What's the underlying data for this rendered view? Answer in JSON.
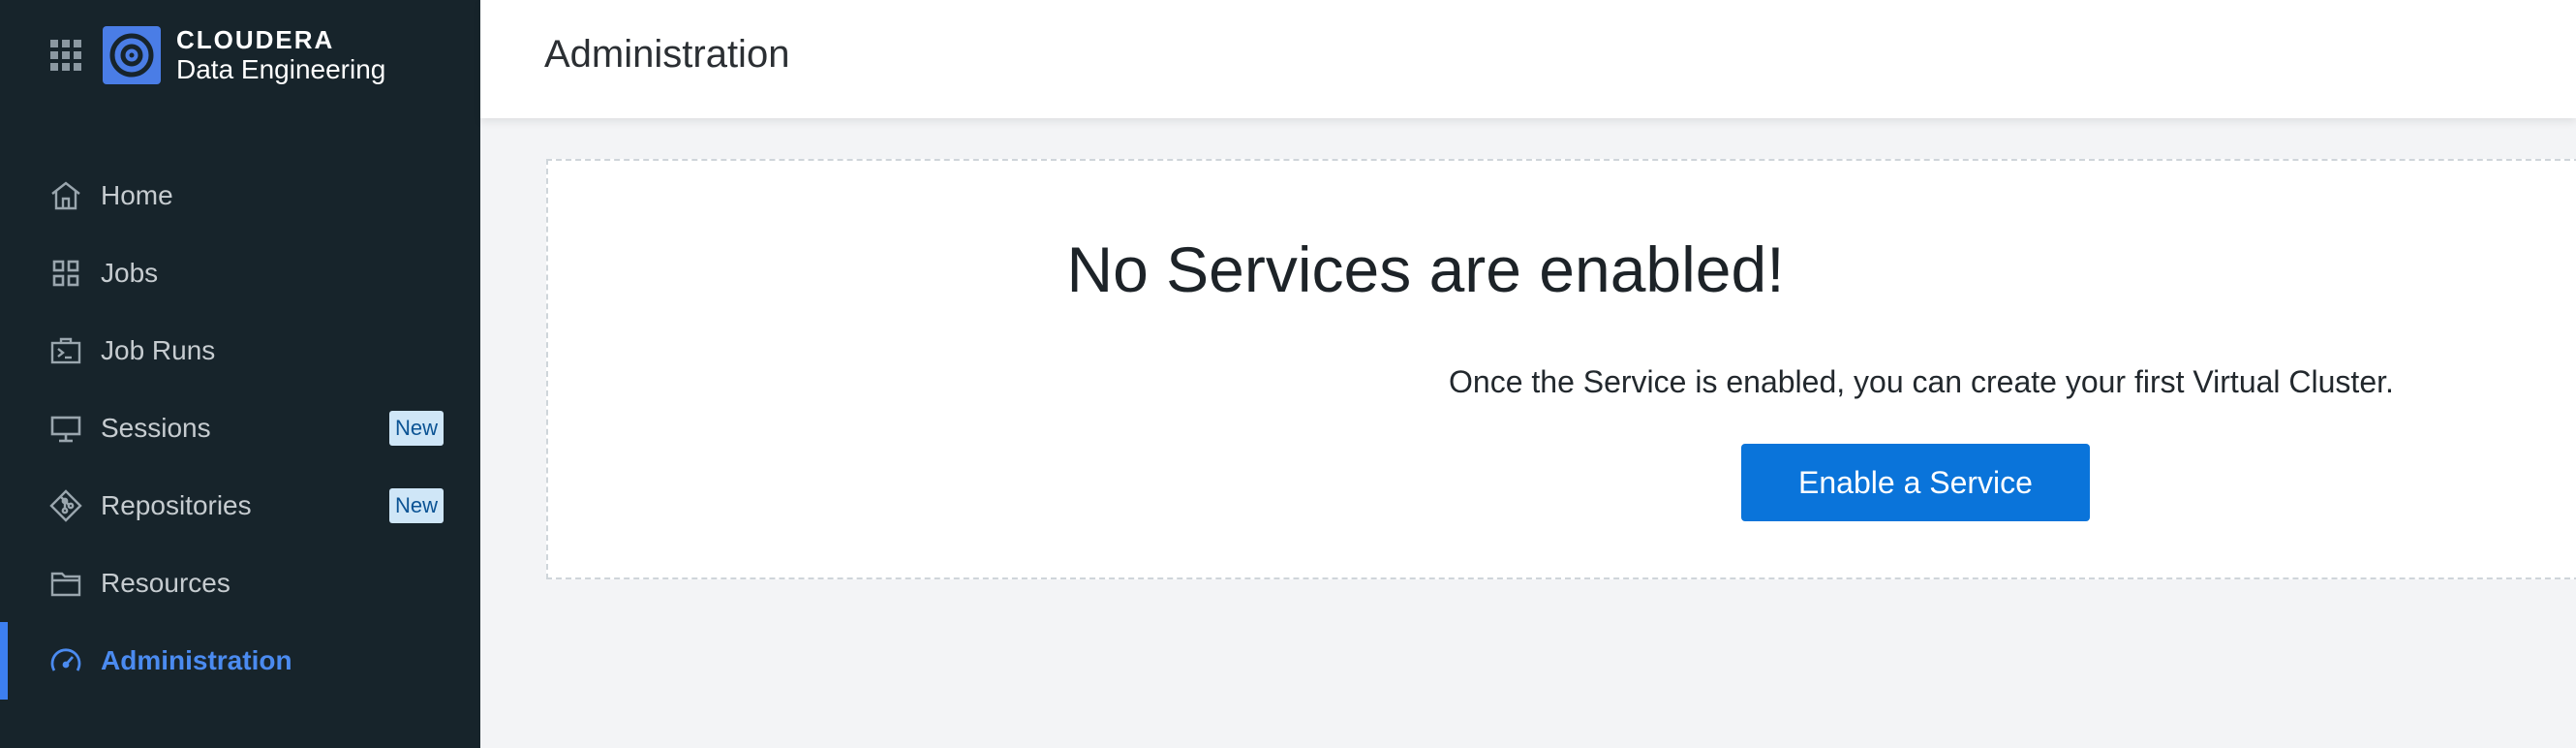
{
  "brand": {
    "company": "CLOUDERA",
    "product": "Data Engineering",
    "logo_color": "#4a7de6"
  },
  "sidebar": {
    "items": [
      {
        "label": "Home",
        "icon": "home-icon"
      },
      {
        "label": "Jobs",
        "icon": "grid-icon"
      },
      {
        "label": "Job Runs",
        "icon": "terminal-case-icon"
      },
      {
        "label": "Sessions",
        "icon": "monitor-icon",
        "badge": "New"
      },
      {
        "label": "Repositories",
        "icon": "git-icon",
        "badge": "New"
      },
      {
        "label": "Resources",
        "icon": "folder-icon"
      },
      {
        "label": "Administration",
        "icon": "gauge-icon",
        "active": true
      }
    ]
  },
  "header": {
    "title": "Administration"
  },
  "main": {
    "empty_title": "No Services are enabled!",
    "empty_message": "Once the Service is enabled, you can create your first Virtual Cluster.",
    "cta_label": "Enable a Service"
  },
  "colors": {
    "sidebar_bg": "#17242b",
    "accent": "#0a74da",
    "active_nav": "#4b8bf0",
    "badge_bg": "#cfe6f7"
  }
}
